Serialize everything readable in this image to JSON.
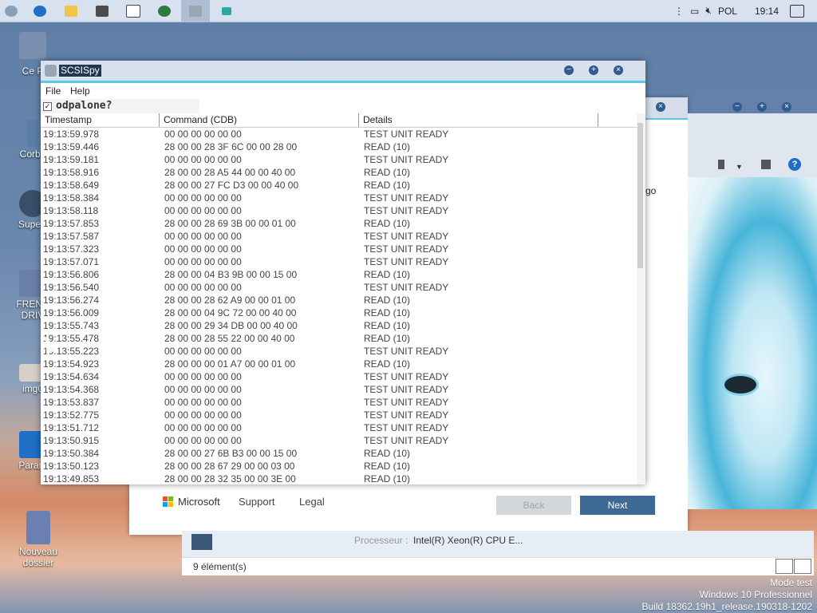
{
  "taskbar": {
    "icons": [
      "shield-icon",
      "edge-icon",
      "file-explorer-icon",
      "store-icon",
      "mail-icon",
      "globe-icon",
      "scsispy-icon",
      "screen-icon"
    ],
    "tray": {
      "language": "POL",
      "time": "19:14"
    }
  },
  "desktop": {
    "icons": [
      {
        "label": "Ce P"
      },
      {
        "label": "Corbe"
      },
      {
        "label": "Superr"
      },
      {
        "label": "FRENC DRIV"
      },
      {
        "label": "img0"
      },
      {
        "label": "Param"
      },
      {
        "label": "Nouveau dossier"
      }
    ],
    "watermark": [
      "Mode test",
      "Windows 10 Professionnel",
      "Build 18362.19h1_release.190318-1202"
    ]
  },
  "background_window": {
    "partial_text": "go",
    "footer": {
      "brand": "Microsoft",
      "support": "Support",
      "legal": "Legal",
      "back": "Back",
      "next": "Next"
    },
    "explorer": {
      "processor_label": "Processeur :",
      "processor_value": "Intel(R) Xeon(R) CPU E...",
      "status": "9 élément(s)"
    }
  },
  "app": {
    "title": "SCSISpy",
    "menu": [
      "File",
      "Help"
    ],
    "option": {
      "checked": true,
      "checkmark": "✓",
      "label": "odpalone?"
    },
    "columns": [
      "Timestamp",
      "Command (CDB)",
      "Details"
    ],
    "rows": [
      [
        "19:13:59.978",
        "00 00 00 00 00 00",
        "TEST UNIT READY"
      ],
      [
        "19:13:59.446",
        "28 00 00 28 3F 6C 00 00 28 00",
        "READ (10)"
      ],
      [
        "19:13:59.181",
        "00 00 00 00 00 00",
        "TEST UNIT READY"
      ],
      [
        "19:13:58.916",
        "28 00 00 28 A5 44 00 00 40 00",
        "READ (10)"
      ],
      [
        "19:13:58.649",
        "28 00 00 27 FC D3 00 00 40 00",
        "READ (10)"
      ],
      [
        "19:13:58.384",
        "00 00 00 00 00 00",
        "TEST UNIT READY"
      ],
      [
        "19:13:58.118",
        "00 00 00 00 00 00",
        "TEST UNIT READY"
      ],
      [
        "19:13:57.853",
        "28 00 00 28 69 3B 00 00 01 00",
        "READ (10)"
      ],
      [
        "19:13:57.587",
        "00 00 00 00 00 00",
        "TEST UNIT READY"
      ],
      [
        "19:13:57.323",
        "00 00 00 00 00 00",
        "TEST UNIT READY"
      ],
      [
        "19:13:57.071",
        "00 00 00 00 00 00",
        "TEST UNIT READY"
      ],
      [
        "19:13:56.806",
        "28 00 00 04 B3 9B 00 00 15 00",
        "READ (10)"
      ],
      [
        "19:13:56.540",
        "00 00 00 00 00 00",
        "TEST UNIT READY"
      ],
      [
        "19:13:56.274",
        "28 00 00 28 62 A9 00 00 01 00",
        "READ (10)"
      ],
      [
        "19:13:56.009",
        "28 00 00 04 9C 72 00 00 40 00",
        "READ (10)"
      ],
      [
        "19:13:55.743",
        "28 00 00 29 34 DB 00 00 40 00",
        "READ (10)"
      ],
      [
        "19:13:55.478",
        "28 00 00 28 55 22 00 00 40 00",
        "READ (10)"
      ],
      [
        "19:13:55.223",
        "00 00 00 00 00 00",
        "TEST UNIT READY"
      ],
      [
        "19:13:54.923",
        "28 00 00 00 01 A7 00 00 01 00",
        "READ (10)"
      ],
      [
        "19:13:54.634",
        "00 00 00 00 00 00",
        "TEST UNIT READY"
      ],
      [
        "19:13:54.368",
        "00 00 00 00 00 00",
        "TEST UNIT READY"
      ],
      [
        "19:13:53.837",
        "00 00 00 00 00 00",
        "TEST UNIT READY"
      ],
      [
        "19:13:52.775",
        "00 00 00 00 00 00",
        "TEST UNIT READY"
      ],
      [
        "19:13:51.712",
        "00 00 00 00 00 00",
        "TEST UNIT READY"
      ],
      [
        "19:13:50.915",
        "00 00 00 00 00 00",
        "TEST UNIT READY"
      ],
      [
        "19:13:50.384",
        "28 00 00 27 6B B3 00 00 15 00",
        "READ (10)"
      ],
      [
        "19:13:50.123",
        "28 00 00 28 67 29 00 00 03 00",
        "READ (10)"
      ],
      [
        "19:13:49.853",
        "28 00 00 28 32 35 00 00 3E 00",
        "READ (10)"
      ]
    ]
  }
}
